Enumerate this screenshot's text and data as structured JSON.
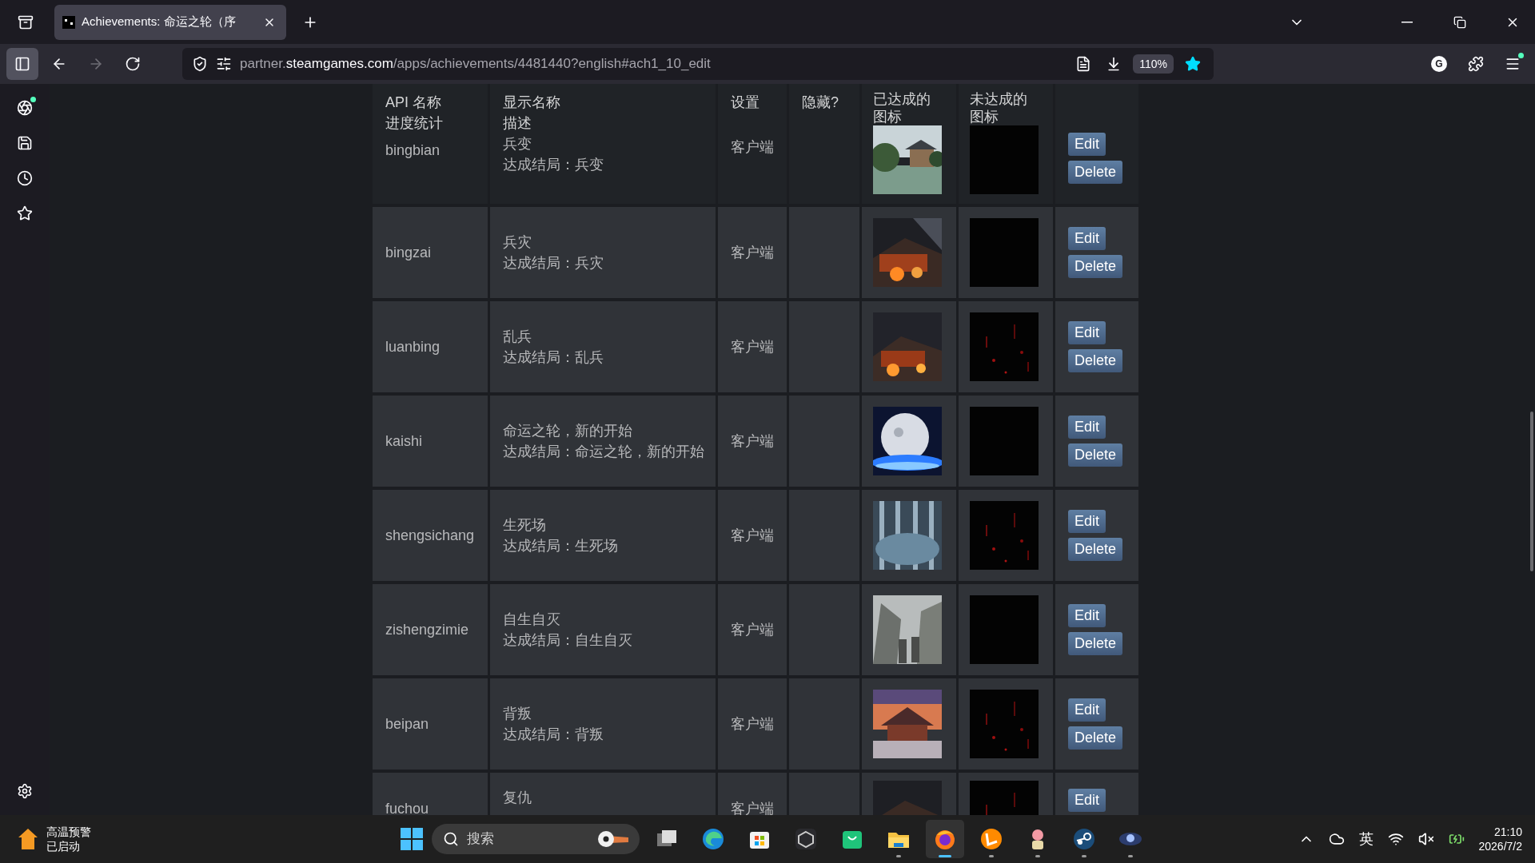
{
  "browser": {
    "tabs": [
      {
        "title": "Achievements: 命运之轮（序",
        "selected": true
      }
    ],
    "toolbar": {
      "forward_disabled": true,
      "url_subdomain": "partner.",
      "url_domain": "steamgames.com",
      "url_path": "/apps/achievements/4481440?english#ach1_10_edit",
      "zoom": "110%",
      "bookmarked": true,
      "avatar": "G",
      "menu_notification": true
    },
    "sidebar": [
      {
        "kind": "assistant",
        "notification": true
      },
      {
        "kind": "save",
        "notification": false
      },
      {
        "kind": "history",
        "notification": false
      },
      {
        "kind": "bookmarks",
        "notification": false
      }
    ]
  },
  "table": {
    "columns": [
      {
        "lines": [
          "API 名称",
          "进度统计"
        ]
      },
      {
        "lines": [
          "显示名称",
          "描述"
        ]
      },
      {
        "lines": [
          "设置"
        ]
      },
      {
        "lines": [
          "隐藏?"
        ]
      },
      {
        "lines": [
          "已达成的",
          "图标"
        ]
      },
      {
        "lines": [
          "未达成的",
          "图标"
        ]
      }
    ],
    "rows": [
      {
        "api_name": "bingbian",
        "display_name": "兵变",
        "description": "达成结局：兵变",
        "setting": "客户端",
        "edit": "Edit",
        "delete": "Delete"
      },
      {
        "api_name": "bingzai",
        "display_name": "兵灾",
        "description": "达成结局：兵灾",
        "setting": "客户端",
        "edit": "Edit",
        "delete": "Delete"
      },
      {
        "api_name": "luanbing",
        "display_name": "乱兵",
        "description": "达成结局：乱兵",
        "setting": "客户端",
        "edit": "Edit",
        "delete": "Delete"
      },
      {
        "api_name": "kaishi",
        "display_name": "命运之轮，新的开始",
        "description": "达成结局：命运之轮，新的开始",
        "setting": "客户端",
        "edit": "Edit",
        "delete": "Delete"
      },
      {
        "api_name": "shengsichang",
        "display_name": "生死场",
        "description": "达成结局：生死场",
        "setting": "客户端",
        "edit": "Edit",
        "delete": "Delete"
      },
      {
        "api_name": "zishengzimie",
        "display_name": "自生自灭",
        "description": "达成结局：自生自灭",
        "setting": "客户端",
        "edit": "Edit",
        "delete": "Delete"
      },
      {
        "api_name": "beipan",
        "display_name": "背叛",
        "description": "达成结局：背叛",
        "setting": "客户端",
        "edit": "Edit",
        "delete": "Delete"
      },
      {
        "api_name": "fuchou",
        "display_name": "复仇",
        "setting": "客户端",
        "edit": "Edit"
      }
    ]
  },
  "taskbar": {
    "weather": {
      "title": "高温预警",
      "subtitle": "已启动"
    },
    "search": {
      "placeholder": "搜索"
    },
    "apps": [
      {
        "kind": "taskview",
        "running": false,
        "active": false
      },
      {
        "kind": "edge",
        "running": false,
        "active": false
      },
      {
        "kind": "store",
        "running": false,
        "active": false
      },
      {
        "kind": "cube",
        "running": false,
        "active": false
      },
      {
        "kind": "bag",
        "running": false,
        "active": false
      },
      {
        "kind": "folder",
        "running": true,
        "active": false
      },
      {
        "kind": "firefox",
        "running": true,
        "active": true
      },
      {
        "kind": "orange",
        "running": true,
        "active": false
      },
      {
        "kind": "figure",
        "running": true,
        "active": false
      },
      {
        "kind": "steam",
        "running": true,
        "active": false
      },
      {
        "kind": "game",
        "running": true,
        "active": false
      }
    ],
    "tray": {
      "ime": "英",
      "time": "21:10",
      "date": "2026/7/2"
    }
  }
}
